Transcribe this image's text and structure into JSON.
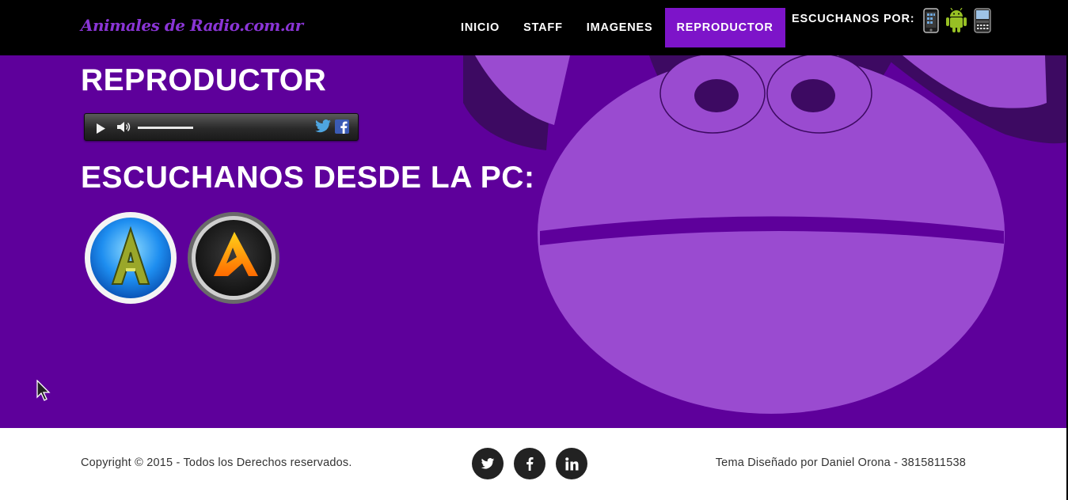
{
  "header": {
    "brand": "Animales de Radio.com.ar",
    "nav": [
      "INICIO",
      "STAFF",
      "IMAGENES",
      "REPRODUCTOR"
    ],
    "active_tab": "REPRODUCTOR",
    "listen_label": "ESCUCHANOS POR:",
    "device_icons": [
      "iphone-icon",
      "android-icon",
      "blackberry-icon"
    ]
  },
  "main": {
    "title": "REPRODUCTOR",
    "player": {
      "controls": [
        "play-icon",
        "volume-icon",
        "volume-slider",
        "twitter-share-icon",
        "facebook-share-icon"
      ],
      "volume_level": 0.4
    },
    "pc_title": "ESCUCHANOS DESDE LA PC:",
    "pc_apps": [
      "aimp-blue-app-icon",
      "aimp-orange-app-icon"
    ]
  },
  "footer": {
    "copyright": "Copyright © 2015 - Todos los Derechos reservados.",
    "credit": "Tema Diseñado por Daniel Orona - 3815811538",
    "social": [
      "twitter-icon",
      "facebook-icon",
      "linkedin-icon"
    ]
  },
  "colors": {
    "hero_bg": "#5e009b",
    "accent": "#7d14c9",
    "monkey_face": "#9a4bd0",
    "monkey_dark": "#3d0a62",
    "nav_bg": "#000000",
    "footer_bg": "#ffffff"
  }
}
